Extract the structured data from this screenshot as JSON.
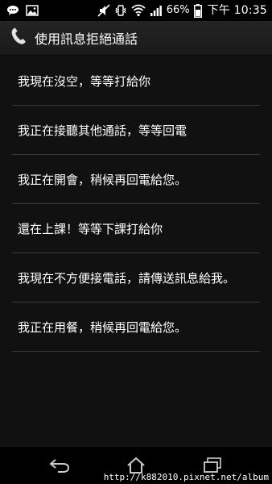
{
  "status_bar": {
    "battery_percent": "66%",
    "time": "下午 10:35",
    "icons": [
      "chat-bubble-icon",
      "image-icon",
      "silent-icon",
      "vibrate-icon",
      "wifi-icon",
      "signal-icon",
      "battery-icon"
    ]
  },
  "header": {
    "icon": "phone-handset-icon",
    "title": "使用訊息拒絕通話"
  },
  "messages": [
    {
      "label": "我現在沒空，等等打給你"
    },
    {
      "label": "我正在接聽其他通話，等等回電"
    },
    {
      "label": "我正在開會，稍候再回電給您。"
    },
    {
      "label": "還在上課！等等下課打給你"
    },
    {
      "label": "我現在不方便接電話，請傳送訊息給我。"
    },
    {
      "label": "我正在用餐，稍候再回電給您。"
    }
  ],
  "nav_bar": {
    "icons": [
      "back-icon",
      "home-icon",
      "recent-apps-icon"
    ]
  },
  "watermark": "http://k882010.pixnet.net/album",
  "colors": {
    "background": "#111111",
    "status_bar": "#000000",
    "divider": "#3a3a3a",
    "text": "#ffffff"
  }
}
